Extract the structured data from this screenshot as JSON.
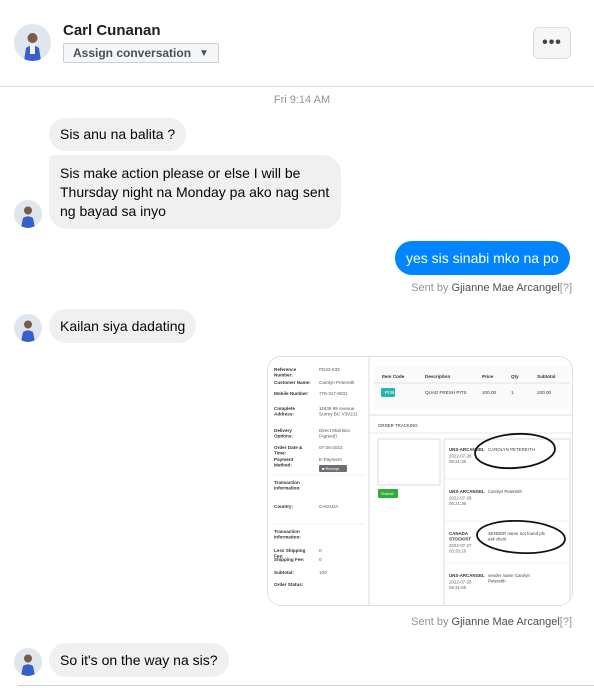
{
  "contact": {
    "name": "Carl Cunanan"
  },
  "header": {
    "assign_label": "Assign conversation",
    "more_label": "•••"
  },
  "thread": {
    "timestamp": "Fri 9:14 AM",
    "messages": [
      {
        "text": "Sis anu na balita ?"
      },
      {
        "text": "Sis make action please or else I will be Thursday night na Monday pa ako nag sent ng bayad sa inyo"
      },
      {
        "text": "yes sis sinabi mko na po"
      },
      {
        "text": "Kailan siya dadating"
      },
      {
        "text": "So it's on the way na sis?"
      }
    ],
    "sent_by": [
      {
        "prefix": "Sent by ",
        "agent": "Gjianne Mae Arcangel",
        "suffix": "[?]"
      },
      {
        "prefix": "Sent by ",
        "agent": "Gjianne Mae Arcangel",
        "suffix": "[?]"
      }
    ]
  },
  "attachment": {
    "left_fields": [
      {
        "label": "Reference Number:",
        "value": "PD43-532"
      },
      {
        "label": "Customer Name:",
        "value": "Carolyn Petereith"
      },
      {
        "label": "Mobile Number:",
        "value": "778-317-5831"
      },
      {
        "label": "Complete Address:",
        "value": "11639 99 Avenue Surrey BC V3V2J1"
      },
      {
        "label": "Delivery Options:",
        "value": "Direct Mail Box (Agreed)"
      },
      {
        "label": "Order Date & Time:",
        "value": "07-26-2022"
      },
      {
        "label": "Payment Method:",
        "value": "E-Payment"
      },
      {
        "label": "receipt",
        "value": "Receipt"
      },
      {
        "label": "Transaction Information:",
        "value": ""
      },
      {
        "label": "Country:",
        "value": "CANADA"
      },
      {
        "label": "Transaction Information:",
        "value": ""
      },
      {
        "label": "Less Shipping Fee:",
        "value": "0"
      },
      {
        "label": "Shipping Fee:",
        "value": "0"
      },
      {
        "label": "Subtotal:",
        "value": "100"
      },
      {
        "label": "Order Status:",
        "value": ""
      }
    ],
    "table": {
      "headers": [
        "Item Code",
        "Description",
        "Price",
        "Qty",
        "Subtotal"
      ],
      "row": [
        "PI36",
        "QUAD FRESH PITS",
        "100.00",
        "1",
        "100.00"
      ]
    },
    "tracking_title": "ORDER TRACKING",
    "submit_label": "Submit",
    "tracking_entries": [
      {
        "who": "UNS-ARCANGEL",
        "date": "2022-07-28 06:21:36",
        "note": "CAROLYN PETEREITH"
      },
      {
        "who": "UNS-ARCANGEL",
        "date": "2022-07-28 06:21:36",
        "note": "Carolyn Petereith"
      },
      {
        "who": "CANADA STOCKIST",
        "date": "2022-07-27 03:33:16",
        "note": "SENDER name not found pls ask client"
      },
      {
        "who": "UNS-ARCANGEL",
        "date": "2022-07-26 05:31:55",
        "note": "sender name Carolyn Petereith"
      }
    ]
  }
}
